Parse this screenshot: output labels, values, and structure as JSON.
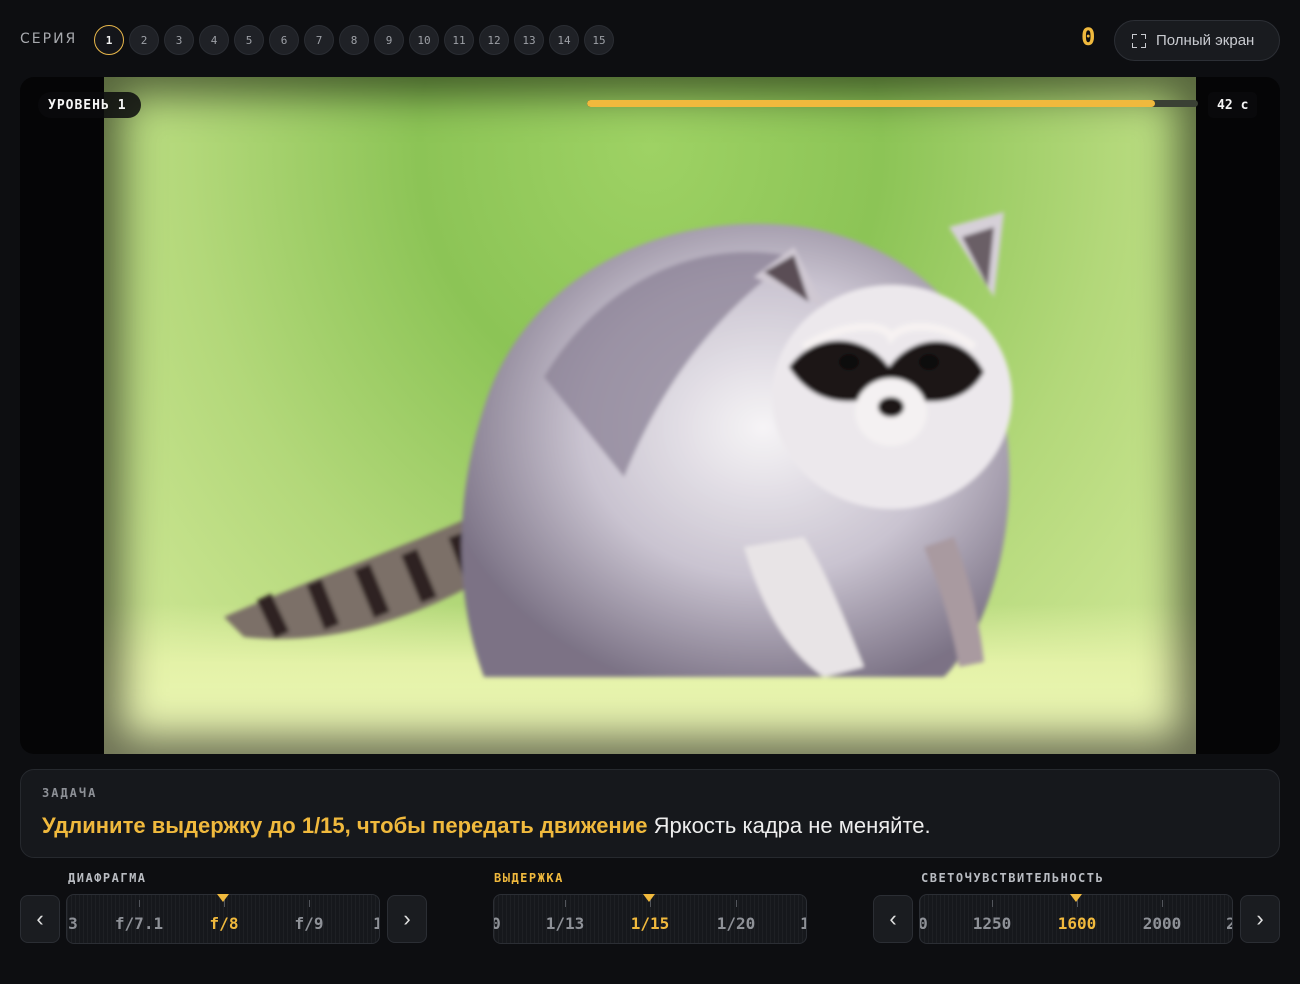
{
  "header": {
    "series_label": "СЕРИЯ",
    "series": [
      "1",
      "2",
      "3",
      "4",
      "5",
      "6",
      "7",
      "8",
      "9",
      "10",
      "11",
      "12",
      "13",
      "14",
      "15"
    ],
    "active_series": "1",
    "score": "0",
    "fullscreen_label": "Полный экран"
  },
  "viewer": {
    "level_label": "УРОВЕНЬ",
    "level_value": "1",
    "timer_progress": 0.93,
    "timer_value": "42",
    "timer_unit": "с"
  },
  "task": {
    "label": "ЗАДАЧА",
    "highlight": "Удлините выдержку до 1/15, чтобы передать движение",
    "text": "Яркость кадра не меняйте."
  },
  "dials": {
    "aperture": {
      "label": "ДИАФРАГМА",
      "edge_left": "3",
      "values": [
        "f/7.1",
        "f/8",
        "f/9"
      ],
      "selected": "f/8",
      "edge_right": "1",
      "prev": "‹",
      "next": "›"
    },
    "shutter": {
      "label": "ВЫДЕРЖКА",
      "edge_left": "0",
      "values": [
        "1/13",
        "1/15",
        "1/20"
      ],
      "selected": "1/15",
      "edge_right": "1",
      "prev": "‹",
      "next": "›"
    },
    "iso": {
      "label": "СВЕТОЧУВСТВИТЕЛЬНОСТЬ",
      "edge_left": "0",
      "values": [
        "1250",
        "1600",
        "2000"
      ],
      "selected": "1600",
      "edge_right": "2",
      "prev": "‹",
      "next": "›"
    }
  },
  "colors": {
    "accent": "#f0b93d",
    "background": "#0d0e11",
    "panel": "#16181c"
  },
  "icons": {
    "fullscreen": "fullscreen-icon",
    "prev": "chevron-left-icon",
    "next": "chevron-right-icon"
  }
}
